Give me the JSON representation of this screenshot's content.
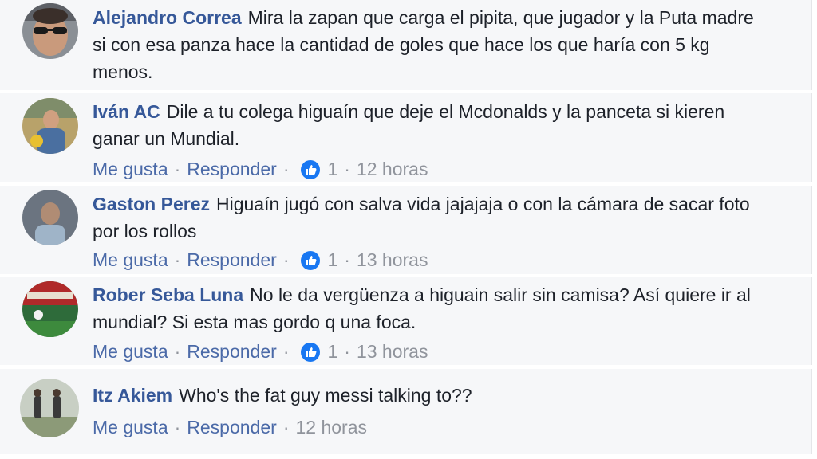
{
  "comments": [
    {
      "author": "Alejandro Correa",
      "text": "Mira la zapan que carga el pipita, que jugador y la Puta madre si con esa panza hace la cantidad de goles que hace los que haría con 5 kg menos."
    },
    {
      "author": "Iván AC",
      "text": "Dile a tu colega higuaín que deje el Mcdonalds y la panceta si kieren ganar un Mundial.",
      "like_label": "Me gusta",
      "reply_label": "Responder",
      "reaction_count": "1",
      "time": "12 horas"
    },
    {
      "author": "Gaston Perez",
      "text": "Higuaín jugó con salva vida jajajaja o con la cámara de sacar foto por los rollos",
      "like_label": "Me gusta",
      "reply_label": "Responder",
      "reaction_count": "1",
      "time": "13 horas"
    },
    {
      "author": "Rober Seba Luna",
      "text": "No le da vergüenza a higuain salir sin camisa? Así quiere ir al mundial? Si esta mas gordo q una foca.",
      "like_label": "Me gusta",
      "reply_label": "Responder",
      "reaction_count": "1",
      "time": "13 horas"
    },
    {
      "author": "Itz Akiem",
      "text": "Who's the fat guy messi talking to??",
      "like_label": "Me gusta",
      "reply_label": "Responder",
      "time": "12 horas"
    }
  ],
  "separator": "·",
  "icons": {
    "reaction": "like-icon"
  },
  "colors": {
    "author": "#365899",
    "link": "#4b6aa8",
    "meta": "#90949c",
    "like_blue": "#1877f2",
    "comment_bg": "#f6f7f9"
  }
}
